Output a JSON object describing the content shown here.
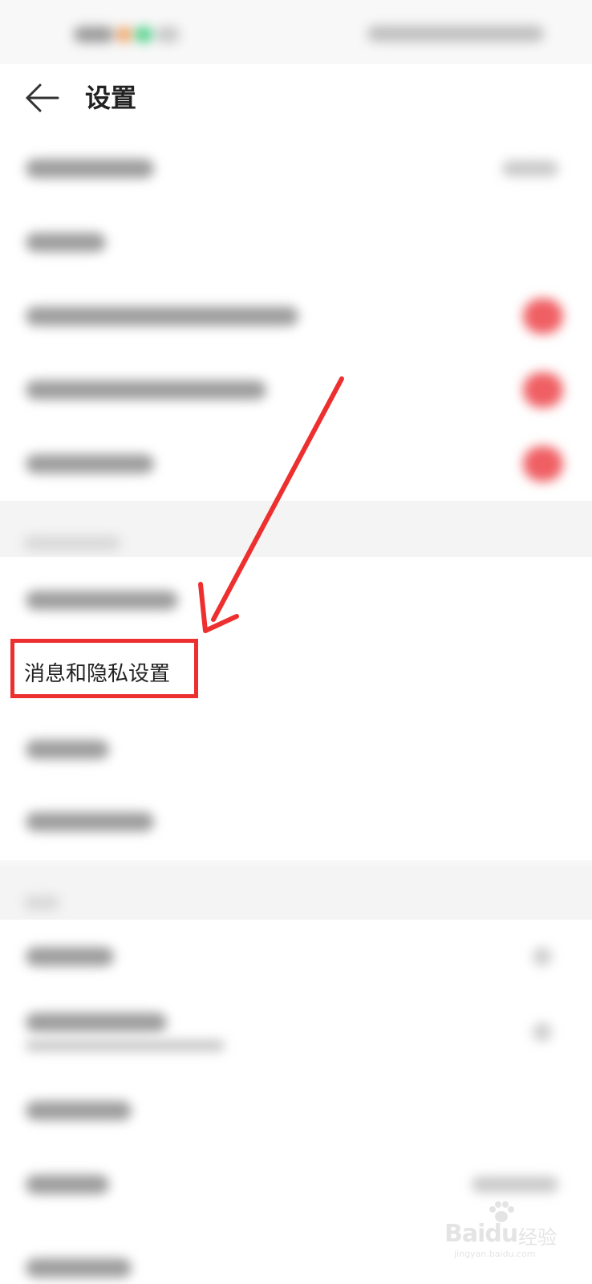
{
  "header": {
    "title": "设置"
  },
  "highlighted_item": {
    "label": "消息和隐私设置"
  },
  "annotation": {
    "arrow_color": "#ee2f2f"
  },
  "watermark": {
    "brand": "Baidu",
    "brand_cn": "经验",
    "url": "jingyan.baidu.com"
  },
  "colors": {
    "toggle_on": "#ef5f63",
    "highlight": "#ee2f2f",
    "background": "#f7f7f7"
  }
}
